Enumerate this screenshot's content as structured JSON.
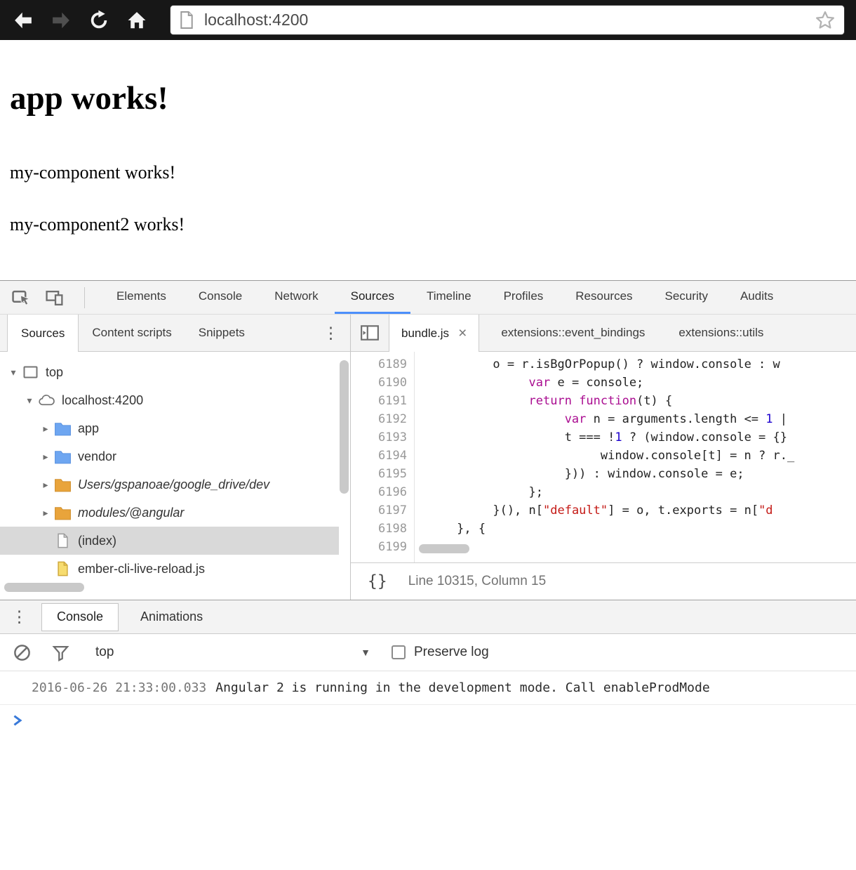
{
  "browser": {
    "url": "localhost:4200"
  },
  "page": {
    "heading": "app works!",
    "paragraphs": [
      "my-component works!",
      "my-component2 works!"
    ]
  },
  "devtools": {
    "main_tabs": [
      "Elements",
      "Console",
      "Network",
      "Sources",
      "Timeline",
      "Profiles",
      "Resources",
      "Security",
      "Audits"
    ],
    "selected_main_tab": "Sources",
    "navigator_tabs": [
      "Sources",
      "Content scripts",
      "Snippets"
    ],
    "selected_navigator_tab": "Sources",
    "file_tabs": [
      {
        "label": "bundle.js",
        "active": true,
        "closable": true
      },
      {
        "label": "extensions::event_bindings",
        "active": false,
        "closable": false
      },
      {
        "label": "extensions::utils",
        "active": false,
        "closable": false
      }
    ],
    "file_tree": [
      {
        "label": "top",
        "icon": "frame-icon",
        "arrow": "expanded",
        "indent": 0
      },
      {
        "label": "localhost:4200",
        "icon": "cloud-icon",
        "arrow": "expanded",
        "indent": 1
      },
      {
        "label": "app",
        "icon": "folder-blue-icon",
        "arrow": "collapsed",
        "indent": 2
      },
      {
        "label": "vendor",
        "icon": "folder-blue-icon",
        "arrow": "collapsed",
        "indent": 2
      },
      {
        "label": "Users/gspanoae/google_drive/dev",
        "icon": "folder-orange-icon",
        "arrow": "collapsed",
        "indent": 2,
        "italic": true
      },
      {
        "label": "modules/@angular",
        "icon": "folder-orange-icon",
        "arrow": "collapsed",
        "indent": 2,
        "italic": true
      },
      {
        "label": "(index)",
        "icon": "file-plain-icon",
        "arrow": "none",
        "indent": 2,
        "selected": true
      },
      {
        "label": "ember-cli-live-reload.js",
        "icon": "file-yellow-icon",
        "arrow": "none",
        "indent": 2
      }
    ],
    "editor": {
      "lines": [
        {
          "num": "6189",
          "indent": 10,
          "tokens": [
            [
              "plain",
              "o = r.isBgOrPopup() ? window.console : w"
            ]
          ]
        },
        {
          "num": "6190",
          "indent": 15,
          "tokens": [
            [
              "keyword",
              "var"
            ],
            [
              "plain",
              " e = console;"
            ]
          ]
        },
        {
          "num": "6191",
          "indent": 15,
          "tokens": [
            [
              "keyword",
              "return"
            ],
            [
              "plain",
              " "
            ],
            [
              "keyword",
              "function"
            ],
            [
              "plain",
              "(t) {"
            ]
          ]
        },
        {
          "num": "6192",
          "indent": 20,
          "tokens": [
            [
              "keyword",
              "var"
            ],
            [
              "plain",
              " n = arguments.length <= "
            ],
            [
              "number",
              "1"
            ],
            [
              "plain",
              " |"
            ]
          ]
        },
        {
          "num": "6193",
          "indent": 20,
          "tokens": [
            [
              "plain",
              "t === !"
            ],
            [
              "number",
              "1"
            ],
            [
              "plain",
              " ? (window.console = {}"
            ]
          ]
        },
        {
          "num": "6194",
          "indent": 25,
          "tokens": [
            [
              "plain",
              "window.console[t] = n ? r._"
            ]
          ]
        },
        {
          "num": "6195",
          "indent": 20,
          "tokens": [
            [
              "plain",
              "})) : window.console = e;"
            ]
          ]
        },
        {
          "num": "6196",
          "indent": 15,
          "tokens": [
            [
              "plain",
              "};"
            ]
          ]
        },
        {
          "num": "6197",
          "indent": 10,
          "tokens": [
            [
              "plain",
              "}(), n["
            ],
            [
              "string",
              "\"default\""
            ],
            [
              "plain",
              "] = o, t.exports = n["
            ],
            [
              "string",
              "\"d"
            ]
          ]
        },
        {
          "num": "6198",
          "indent": 5,
          "tokens": [
            [
              "plain",
              "}, {"
            ]
          ]
        },
        {
          "num": "6199",
          "indent": 0,
          "tokens": []
        }
      ],
      "status": "Line 10315, Column 15",
      "format_icon": "{}"
    },
    "console": {
      "tabs": [
        "Console",
        "Animations"
      ],
      "selected_tab": "Console",
      "context": "top",
      "preserve_log_label": "Preserve log",
      "preserve_log_checked": false,
      "message_timestamp": "2016-06-26 21:33:00.033",
      "message_text": "Angular 2 is running in the development mode. Call enableProdMode"
    },
    "colors": {
      "accent_blue": "#4c8ffb",
      "keyword": "#aa0d91",
      "number": "#1c00cf",
      "string": "#c41a16"
    }
  }
}
